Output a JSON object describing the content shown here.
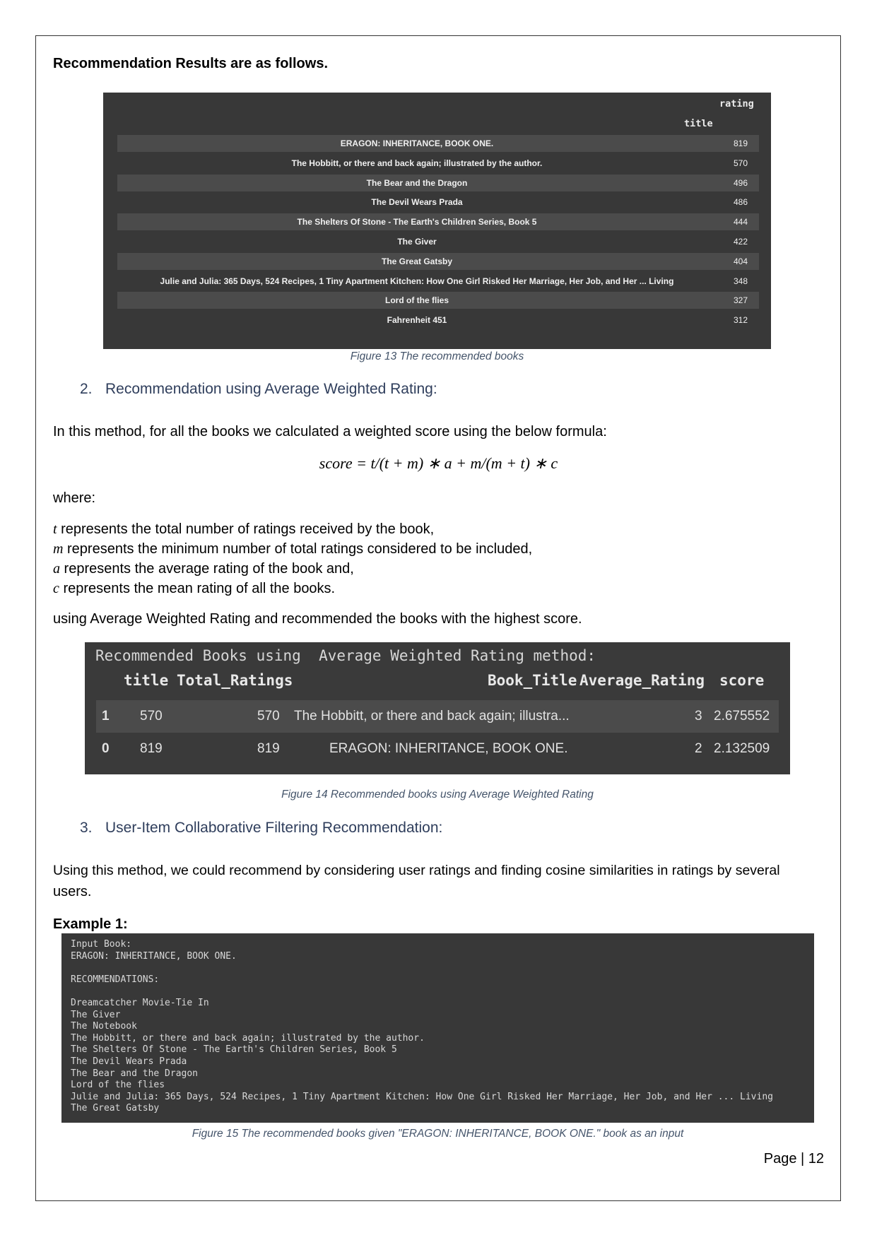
{
  "intro": "Recommendation Results are as follows.",
  "figure13": {
    "header_rating": "rating",
    "header_title": "title",
    "rows": [
      {
        "title": "ERAGON: INHERITANCE, BOOK ONE.",
        "rating": "819"
      },
      {
        "title": "The Hobbitt, or there and back again; illustrated by the author.",
        "rating": "570"
      },
      {
        "title": "The Bear and the Dragon",
        "rating": "496"
      },
      {
        "title": "The Devil Wears Prada",
        "rating": "486"
      },
      {
        "title": "The Shelters Of Stone - The Earth's Children Series, Book 5",
        "rating": "444"
      },
      {
        "title": "The Giver",
        "rating": "422"
      },
      {
        "title": "The Great Gatsby",
        "rating": "404"
      },
      {
        "title": "Julie and Julia: 365 Days, 524 Recipes, 1 Tiny Apartment Kitchen: How One Girl Risked Her Marriage, Her Job, and Her ... Living",
        "rating": "348"
      },
      {
        "title": "Lord of the flies",
        "rating": "327"
      },
      {
        "title": "Fahrenheit 451",
        "rating": "312"
      }
    ],
    "caption": "Figure 13 The recommended books"
  },
  "section2": {
    "number": "2.",
    "heading": "Recommendation using Average Weighted Rating:",
    "para1": "In this method, for all the books we calculated a weighted score using the below formula:",
    "formula": "score = t/(t + m) ∗ a + m/(m + t) ∗ c",
    "where": "where:",
    "defs": [
      {
        "sym": "t",
        "text": " represents the total number of ratings received by the book,"
      },
      {
        "sym": "m",
        "text": " represents the minimum number of total ratings considered to be included,"
      },
      {
        "sym": "a",
        "text": " represents the average rating of the book and,"
      },
      {
        "sym": "c",
        "text": " represents the mean rating of all the books."
      }
    ],
    "para2": "using Average Weighted Rating and recommended the books with the highest score."
  },
  "figure14": {
    "title_line": "Recommended Books using  Average Weighted Rating method:",
    "columns": [
      "title",
      "Total_Ratings",
      "Book_Title",
      "Average_Rating",
      "score"
    ],
    "rows": [
      {
        "index": "1",
        "title": "570",
        "total": "570",
        "book": "The Hobbitt, or there and back again; illustra...",
        "avg": "3",
        "score": "2.675552"
      },
      {
        "index": "0",
        "title": "819",
        "total": "819",
        "book": "ERAGON: INHERITANCE, BOOK ONE.",
        "avg": "2",
        "score": "2.132509"
      }
    ],
    "caption": "Figure 14 Recommended books using Average Weighted Rating"
  },
  "section3": {
    "number": "3.",
    "heading": "User-Item Collaborative Filtering Recommendation:",
    "para_line1": "Using this method, we could recommend by considering user ratings and finding cosine similarities in ratings by several",
    "para_line2": "users.",
    "example": "Example 1:"
  },
  "figure15": {
    "lines": [
      "Input Book:",
      "ERAGON: INHERITANCE, BOOK ONE.",
      "",
      "RECOMMENDATIONS:",
      "",
      "Dreamcatcher Movie-Tie In",
      "The Giver",
      "The Notebook",
      "The Hobbitt, or there and back again; illustrated by the author.",
      "The Shelters Of Stone - The Earth's Children Series, Book 5",
      "The Devil Wears Prada",
      "The Bear and the Dragon",
      "Lord of the flies",
      "Julie and Julia: 365 Days, 524 Recipes, 1 Tiny Apartment Kitchen: How One Girl Risked Her Marriage, Her Job, and Her ... Living",
      "The Great Gatsby"
    ],
    "caption": "Figure 15 The recommended books given \"ERAGON: INHERITANCE, BOOK ONE.\" book as an input"
  },
  "footer": {
    "page": "Page | 12"
  }
}
